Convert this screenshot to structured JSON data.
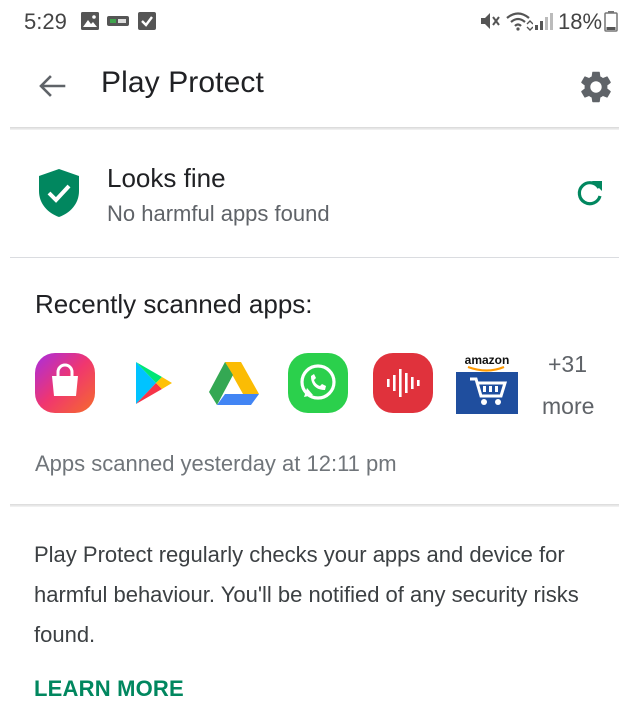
{
  "status_bar": {
    "time": "5:29",
    "battery_percent": "18%",
    "icons": [
      "image-icon",
      "notification-app-icon",
      "checkbox-notification-icon",
      "mute-icon",
      "wifi-icon",
      "signal-icon",
      "battery-icon"
    ]
  },
  "app_bar": {
    "title": "Play Protect",
    "back_icon": "arrow-left-icon",
    "settings_icon": "gear-icon"
  },
  "status": {
    "title": "Looks fine",
    "subtitle": "No harmful apps found",
    "shield_icon": "shield-check-icon",
    "refresh_icon": "refresh-icon",
    "accent_color": "#01875f"
  },
  "recent": {
    "title": "Recently scanned apps:",
    "apps": [
      "galaxy-store-icon",
      "play-store-icon",
      "google-drive-icon",
      "whatsapp-icon",
      "voice-recorder-icon",
      "amazon-shopping-icon"
    ],
    "amazon_label": "amazon",
    "more_count": "+31",
    "more_label": "more",
    "scan_time": "Apps scanned yesterday at 12:11 pm"
  },
  "info": {
    "description": "Play Protect regularly checks your apps and device for harmful behaviour. You'll be notified of any security risks found.",
    "learn_more": "LEARN MORE"
  }
}
